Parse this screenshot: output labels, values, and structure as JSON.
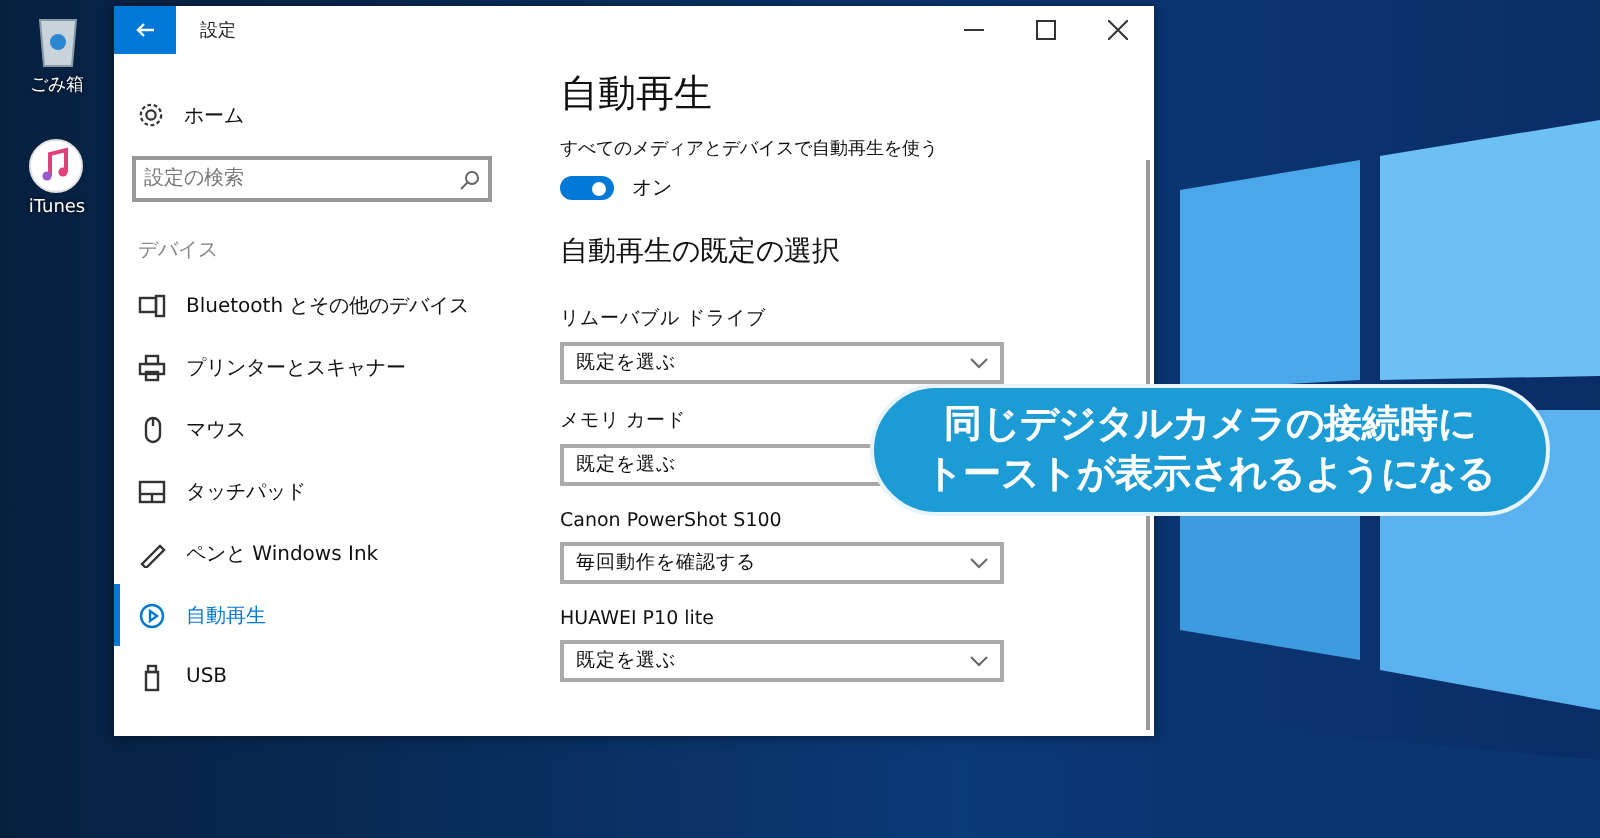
{
  "desktop_icons": [
    {
      "label": "ごみ箱",
      "kind": "trash"
    },
    {
      "label": "iTunes",
      "kind": "music"
    }
  ],
  "window": {
    "title": "設定"
  },
  "sidebar": {
    "home": "ホーム",
    "search": {
      "placeholder": "設定の検索"
    },
    "section": "デバイス",
    "items": [
      {
        "label": "Bluetooth とその他のデバイス",
        "selected": false
      },
      {
        "label": "プリンターとスキャナー",
        "selected": false
      },
      {
        "label": "マウス",
        "selected": false
      },
      {
        "label": "タッチパッド",
        "selected": false
      },
      {
        "label": "ペンと Windows Ink",
        "selected": false
      },
      {
        "label": "自動再生",
        "selected": true
      },
      {
        "label": "USB",
        "selected": false
      }
    ]
  },
  "content": {
    "title": "自動再生",
    "toggle": {
      "label": "すべてのメディアとデバイスで自動再生を使う",
      "on": true,
      "state_text": "オン"
    },
    "subtitle": "自動再生の既定の選択",
    "dropdowns": [
      {
        "label": "リムーバブル ドライブ",
        "value": "既定を選ぶ"
      },
      {
        "label": "メモリ カード",
        "value": "既定を選ぶ"
      },
      {
        "label": "Canon PowerShot S100",
        "value": "毎回動作を確認する"
      },
      {
        "label": "HUAWEI P10 lite",
        "value": "既定を選ぶ"
      }
    ]
  },
  "caption": {
    "lines": [
      "同じデジタルカメラの接続時に",
      "トーストが表示されるようになる"
    ]
  }
}
